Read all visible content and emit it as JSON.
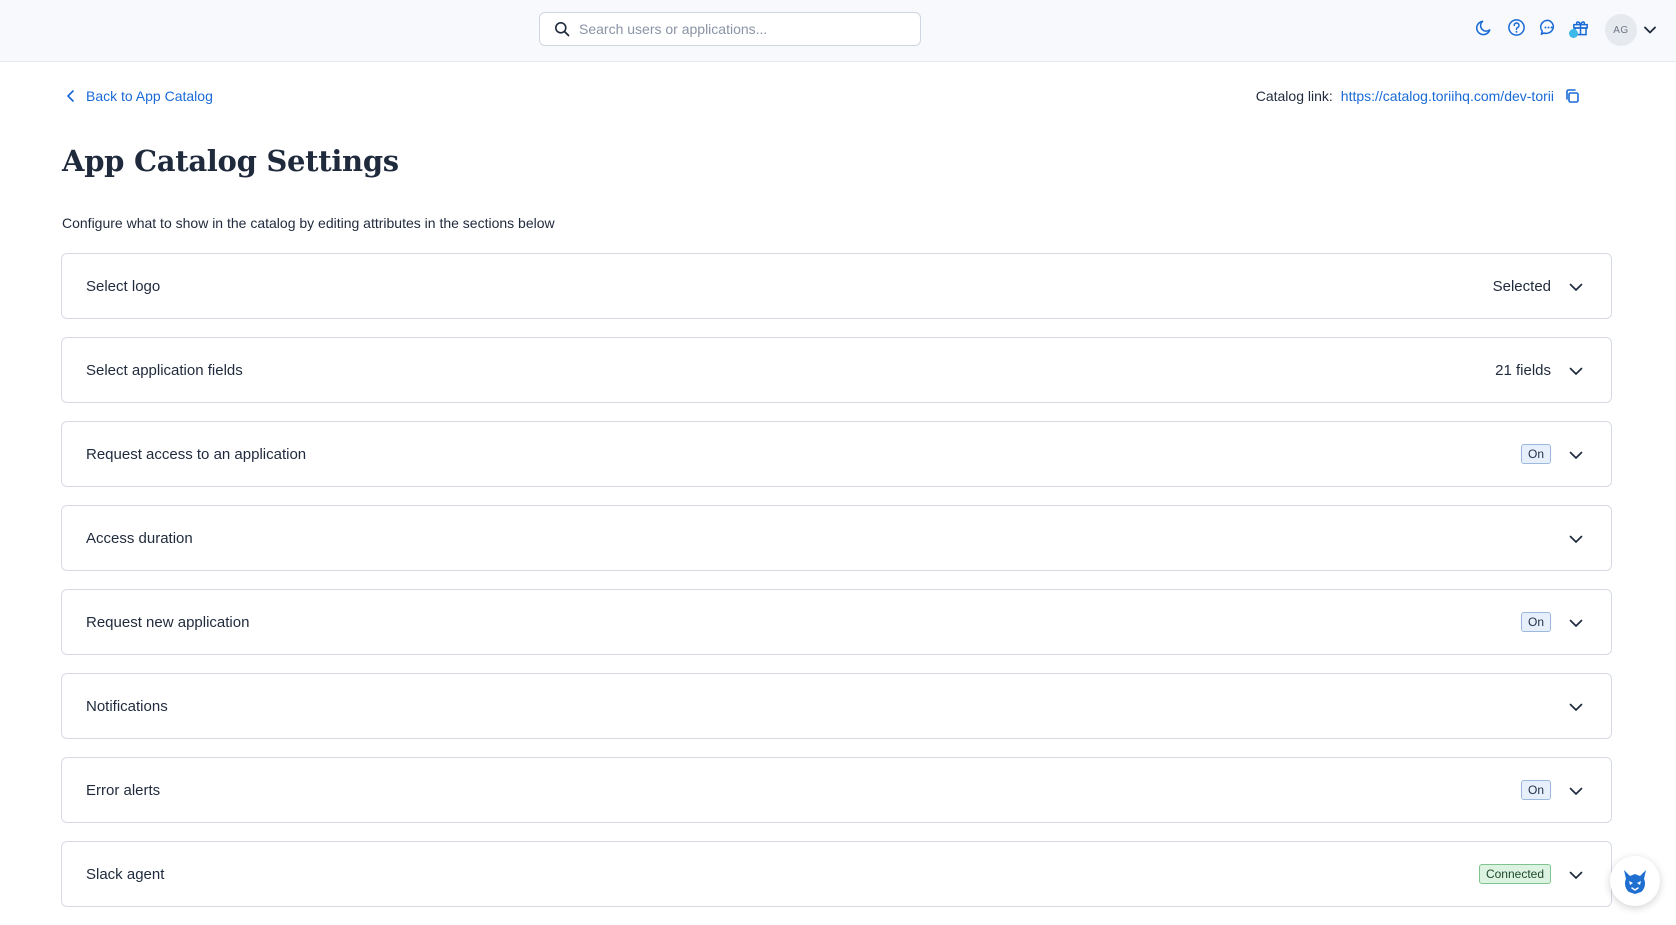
{
  "header": {
    "search_placeholder": "Search users or applications...",
    "icons": [
      "moon-icon",
      "help-icon",
      "chat-icon",
      "gift-icon"
    ],
    "avatar_initials": "AG"
  },
  "nav": {
    "back_label": "Back to App Catalog",
    "catalog_link_label": "Catalog link:",
    "catalog_link_url": "https://catalog.toriihq.com/dev-torii"
  },
  "page": {
    "title": "App Catalog Settings",
    "subtitle": "Configure what to show in the catalog by editing attributes in the sections below"
  },
  "sections": [
    {
      "title": "Select logo",
      "status_text": "Selected",
      "badge": ""
    },
    {
      "title": "Select application fields",
      "status_text": "21 fields",
      "badge": ""
    },
    {
      "title": "Request access to an application",
      "status_text": "",
      "badge": "On"
    },
    {
      "title": "Access duration",
      "status_text": "",
      "badge": ""
    },
    {
      "title": "Request new application",
      "status_text": "",
      "badge": "On"
    },
    {
      "title": "Notifications",
      "status_text": "",
      "badge": ""
    },
    {
      "title": "Error alerts",
      "status_text": "",
      "badge": "On"
    },
    {
      "title": "Slack agent",
      "status_text": "",
      "badge": "Connected"
    }
  ],
  "colors": {
    "link": "#1a6ad6",
    "on_badge_bg": "#e7effb",
    "connected_badge_bg": "#ddf3e1",
    "notification_dot": "#3cb9e8"
  }
}
